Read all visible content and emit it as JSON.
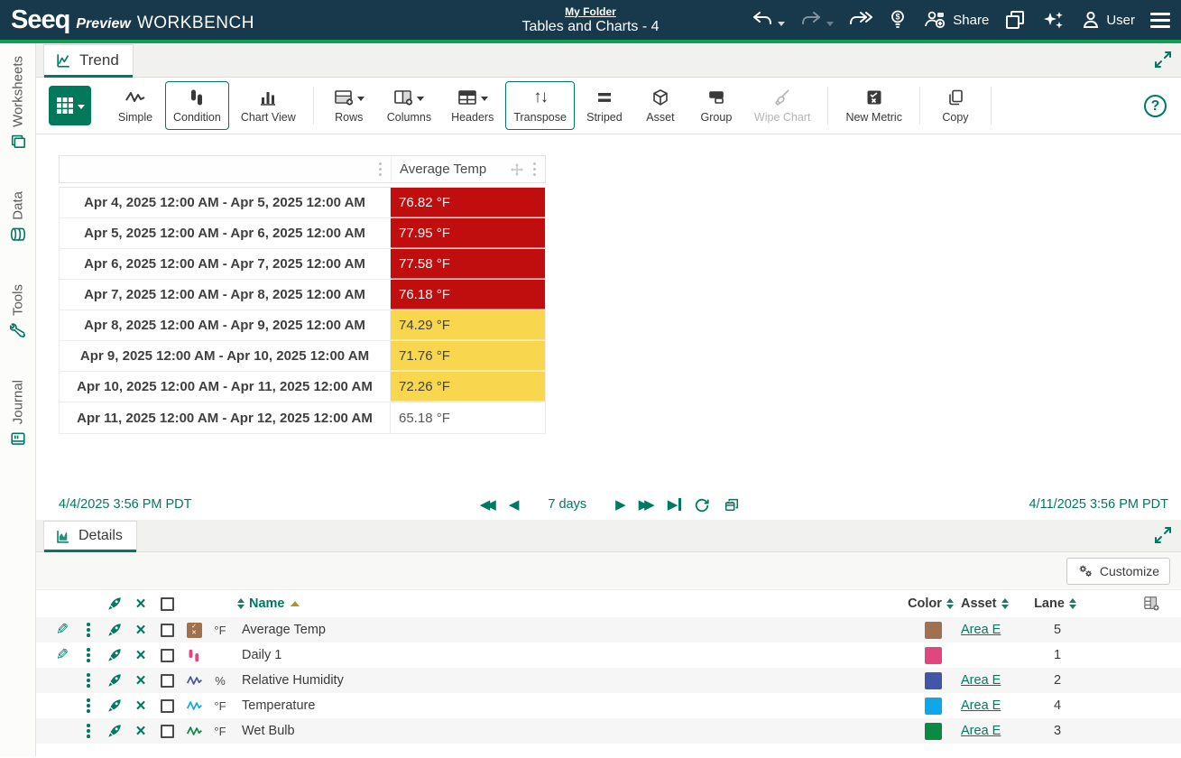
{
  "header": {
    "brand": "Seeq",
    "brand_preview": "Preview",
    "brand_product": "WORKBENCH",
    "folder_link": "My Folder",
    "worksheet_title": "Tables and Charts - 4",
    "share_label": "Share",
    "user_label": "User"
  },
  "sidebar": {
    "items": [
      {
        "label": "Worksheets"
      },
      {
        "label": "Data"
      },
      {
        "label": "Tools"
      },
      {
        "label": "Journal"
      }
    ]
  },
  "trend": {
    "tab_label": "Trend",
    "toolbar": {
      "buttons": [
        {
          "label": "Simple"
        },
        {
          "label": "Condition",
          "state": "active"
        },
        {
          "label": "Chart View"
        },
        {
          "label": "Rows"
        },
        {
          "label": "Columns"
        },
        {
          "label": "Headers"
        },
        {
          "label": "Transpose",
          "state": "active"
        },
        {
          "label": "Striped"
        },
        {
          "label": "Asset"
        },
        {
          "label": "Group"
        },
        {
          "label": "Wipe Chart",
          "state": "disabled"
        },
        {
          "label": "New Metric"
        },
        {
          "label": "Copy"
        }
      ]
    },
    "table": {
      "value_column": "Average Temp",
      "rows": [
        {
          "range": "Apr 4, 2025 12:00 AM - Apr 5, 2025 12:00 AM",
          "value": "76.82 °F",
          "bg": "#C00D0D",
          "fg": "#FFFFFF"
        },
        {
          "range": "Apr 5, 2025 12:00 AM - Apr 6, 2025 12:00 AM",
          "value": "77.95 °F",
          "bg": "#C00D0D",
          "fg": "#FFFFFF"
        },
        {
          "range": "Apr 6, 2025 12:00 AM - Apr 7, 2025 12:00 AM",
          "value": "77.58 °F",
          "bg": "#C00D0D",
          "fg": "#FFFFFF"
        },
        {
          "range": "Apr 7, 2025 12:00 AM - Apr 8, 2025 12:00 AM",
          "value": "76.18 °F",
          "bg": "#C00D0D",
          "fg": "#FFFFFF"
        },
        {
          "range": "Apr 8, 2025 12:00 AM - Apr 9, 2025 12:00 AM",
          "value": "74.29 °F",
          "bg": "#F8D64E",
          "fg": "#403F3F"
        },
        {
          "range": "Apr 9, 2025 12:00 AM - Apr 10, 2025 12:00 AM",
          "value": "71.76 °F",
          "bg": "#F8D64E",
          "fg": "#403F3F"
        },
        {
          "range": "Apr 10, 2025 12:00 AM - Apr 11, 2025 12:00 AM",
          "value": "72.26 °F",
          "bg": "#F8D64E",
          "fg": "#403F3F"
        },
        {
          "range": "Apr 11, 2025 12:00 AM - Apr 12, 2025 12:00 AM",
          "value": "65.18 °F",
          "bg": "#FFFFFF",
          "fg": "#595959"
        }
      ]
    },
    "timebar": {
      "start": "4/4/2025 3:56 PM  PDT",
      "duration": "7 days",
      "end": "4/11/2025 3:56 PM  PDT"
    }
  },
  "details": {
    "tab_label": "Details",
    "customize_label": "Customize",
    "columns": {
      "name": "Name",
      "color": "Color",
      "asset": "Asset",
      "lane": "Lane"
    },
    "items": [
      {
        "name": "Average Temp",
        "unit": "°F",
        "type": "metric",
        "swatch": "#A0714F",
        "asset": "Area E",
        "lane": "5"
      },
      {
        "name": "Daily 1",
        "unit": "",
        "type": "condition",
        "swatch": "#E2467F",
        "asset": "",
        "lane": "1"
      },
      {
        "name": "Relative Humidity",
        "unit": "%",
        "type": "signal",
        "swatch": "#4156A8",
        "asset": "Area E",
        "lane": "2"
      },
      {
        "name": "Temperature",
        "unit": "°F",
        "type": "signal",
        "swatch": "#0EA7E8",
        "asset": "Area E",
        "lane": "4"
      },
      {
        "name": "Wet Bulb",
        "unit": "°F",
        "type": "signal",
        "swatch": "#0A8A43",
        "asset": "Area E",
        "lane": "3"
      }
    ]
  },
  "colors": {
    "header_bg": "#17394B",
    "accent_green": "#0BA14F",
    "teal": "#007960",
    "cell_red": "#C00D0D",
    "cell_yellow": "#F8D64E"
  }
}
